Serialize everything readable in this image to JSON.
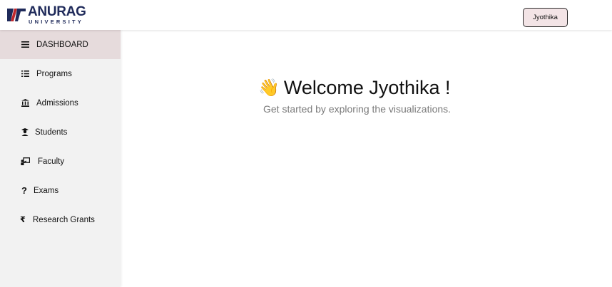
{
  "header": {
    "logo_name": "ANURAG",
    "logo_sub": "UNIVERSITY",
    "user_label": "Jyothika"
  },
  "sidebar": {
    "items": [
      {
        "label": "DASHBOARD",
        "icon": "menu-icon",
        "active": true
      },
      {
        "label": "Programs",
        "icon": "list-icon",
        "active": false
      },
      {
        "label": "Admissions",
        "icon": "institution-icon",
        "active": false
      },
      {
        "label": "Students",
        "icon": "student-icon",
        "active": false
      },
      {
        "label": "Faculty",
        "icon": "teacher-icon",
        "active": false
      },
      {
        "label": "Exams",
        "icon": "question-icon",
        "active": false
      },
      {
        "label": "Research Grants",
        "icon": "rupee-icon",
        "active": false
      }
    ]
  },
  "main": {
    "wave_emoji": "👋",
    "welcome": "Welcome Jyothika !",
    "subtitle": "Get started by exploring the visualizations."
  },
  "colors": {
    "brand_navy": "#1f2a5a",
    "brand_red": "#c0282d",
    "active_item_bg": "#e6dbdc",
    "user_button_bg": "#f3e4e6"
  }
}
